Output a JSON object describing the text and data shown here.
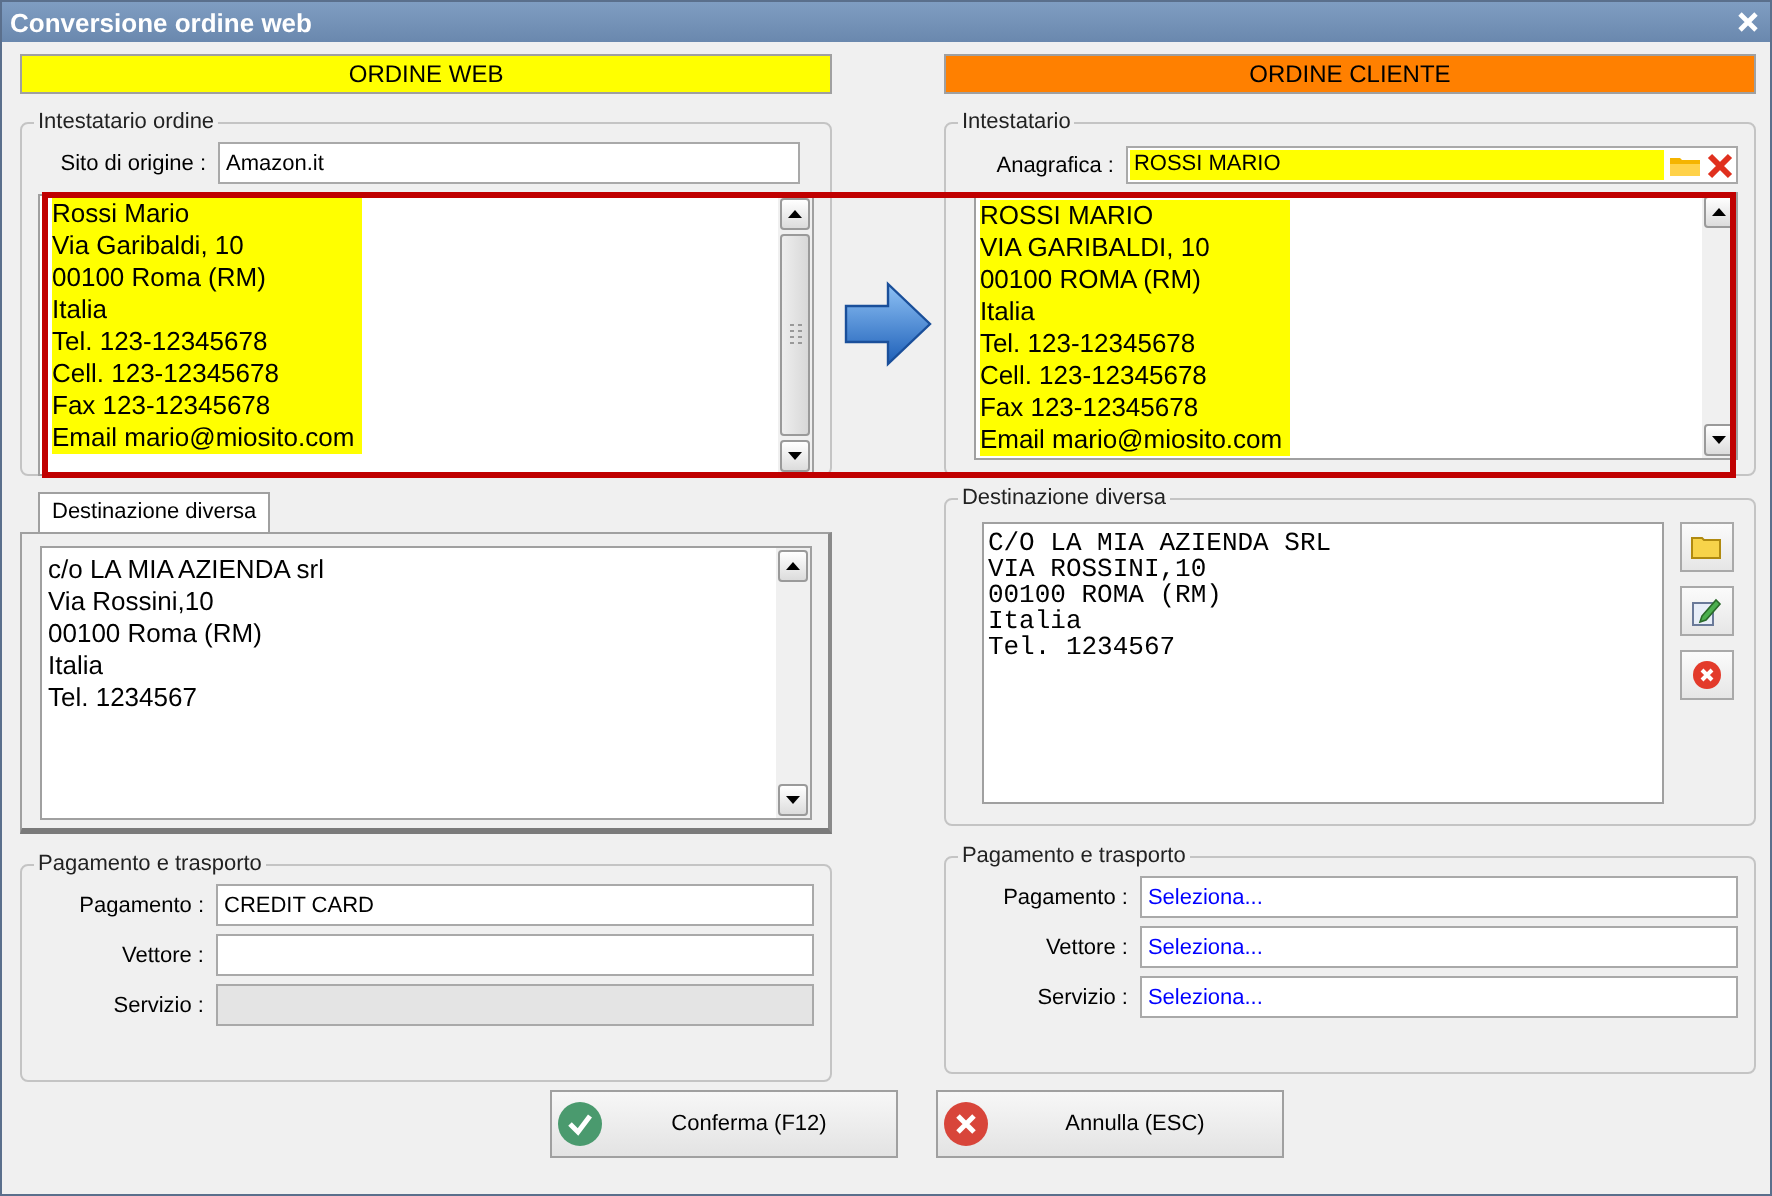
{
  "window": {
    "title": "Conversione ordine web"
  },
  "comparison_highlight": true,
  "web_order": {
    "header": "ORDINE WEB",
    "color": "#ffff00",
    "holder": {
      "legend": "Intestatario ordine",
      "site_label": "Sito di origine :",
      "site_value": "Amazon.it",
      "highlighted": true,
      "lines": [
        "Rossi Mario",
        "Via Garibaldi, 10",
        "00100 Roma (RM)",
        "Italia",
        "Tel. 123-12345678",
        "Cell. 123-12345678",
        "Fax 123-12345678",
        "Email mario@miosito.com"
      ]
    },
    "destination": {
      "tab": "Destinazione diversa",
      "lines": [
        "c/o LA MIA AZIENDA srl",
        "Via Rossini,10",
        "00100 Roma (RM)",
        "Italia",
        "Tel. 1234567"
      ]
    },
    "payment": {
      "legend": "Pagamento e trasporto",
      "fields": [
        {
          "label": "Pagamento :",
          "value": "CREDIT CARD",
          "disabled": false
        },
        {
          "label": "Vettore :",
          "disabled": false
        },
        {
          "label": "Servizio :",
          "disabled": true
        }
      ]
    }
  },
  "customer_order": {
    "header": "ORDINE CLIENTE",
    "color": "#ff8000",
    "holder": {
      "legend": "Intestatario",
      "registry_label": "Anagrafica :",
      "registry_value": "ROSSI MARIO",
      "highlighted": true,
      "lines": [
        "ROSSI MARIO",
        "VIA GARIBALDI, 10",
        "00100 ROMA (RM)",
        "Italia",
        "Tel. 123-12345678",
        "Cell. 123-12345678",
        "Fax 123-12345678",
        "Email mario@miosito.com"
      ]
    },
    "destination": {
      "legend": "Destinazione diversa",
      "lines": [
        "C/O LA MIA AZIENDA SRL",
        "VIA ROSSINI,10",
        "00100 ROMA (RM)",
        "Italia",
        "Tel. 1234567"
      ]
    },
    "payment": {
      "legend": "Pagamento e trasporto",
      "fields": [
        {
          "label": "Pagamento :",
          "value": "Seleziona...",
          "kind": "selector",
          "disabled": false
        },
        {
          "label": "Vettore :",
          "value": "Seleziona...",
          "kind": "selector",
          "disabled": false
        },
        {
          "label": "Servizio :",
          "value": "Seleziona...",
          "kind": "selector",
          "disabled": false
        }
      ]
    }
  },
  "buttons": [
    {
      "label": "Conferma (F12)",
      "kind": "confirm"
    },
    {
      "label": "Annulla (ESC)",
      "kind": "cancel"
    }
  ]
}
